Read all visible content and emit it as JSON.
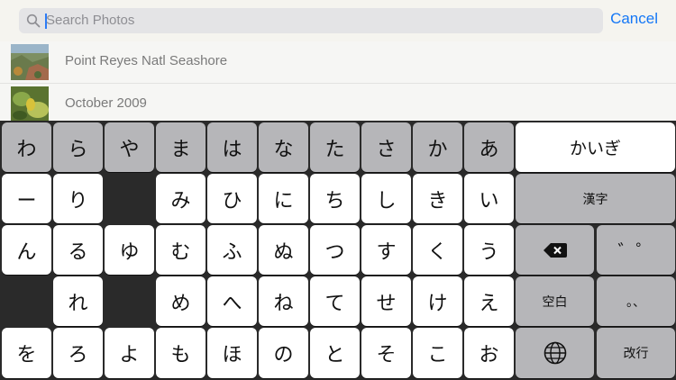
{
  "search": {
    "placeholder": "Search Photos",
    "value": "",
    "cancel_label": "Cancel"
  },
  "results": [
    {
      "label": "Point Reyes Natl Seashore"
    },
    {
      "label": "October 2009"
    }
  ],
  "keyboard": {
    "row1": [
      "わ",
      "ら",
      "や",
      "ま",
      "は",
      "な",
      "た",
      "さ",
      "か",
      "あ"
    ],
    "row2": [
      "ー",
      "り",
      "",
      "み",
      "ひ",
      "に",
      "ち",
      "し",
      "き",
      "い"
    ],
    "row3": [
      "ん",
      "る",
      "ゆ",
      "む",
      "ふ",
      "ぬ",
      "つ",
      "す",
      "く",
      "う"
    ],
    "row4": [
      "",
      "れ",
      "",
      "め",
      "へ",
      "ね",
      "て",
      "せ",
      "け",
      "え"
    ],
    "row5": [
      "を",
      "ろ",
      "よ",
      "も",
      "ほ",
      "の",
      "と",
      "そ",
      "こ",
      "お"
    ],
    "kaigyo_suggestion": "かいぎ",
    "kanji_label": "漢字",
    "dakuten_label": "゛゜",
    "space_label": "空白",
    "punct_label": "。、",
    "return_label": "改行",
    "delete_icon": "backspace-icon",
    "globe_icon": "globe-icon"
  }
}
